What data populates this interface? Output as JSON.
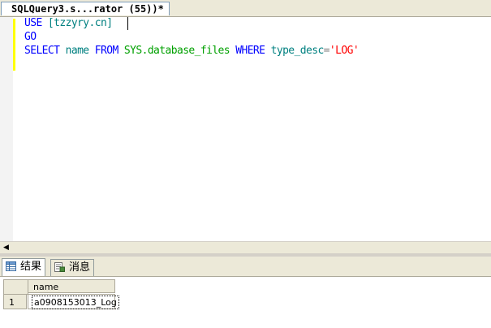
{
  "document_tab": {
    "title": "SQLQuery3.s...rator (55))*"
  },
  "editor": {
    "line1": {
      "kw_use": "USE",
      "db": "[tzzyry.cn]"
    },
    "line2": {
      "kw_go": "GO"
    },
    "line3": {
      "kw_select": "SELECT",
      "col": "name",
      "kw_from": "FROM",
      "table": "SYS.database_files",
      "kw_where": "WHERE",
      "filter_col": "type_desc",
      "op": "=",
      "value": "'LOG'"
    }
  },
  "result_tabs": [
    {
      "label": "结果",
      "icon": "grid-icon"
    },
    {
      "label": "消息",
      "icon": "messages-icon"
    }
  ],
  "grid": {
    "columns": [
      "name"
    ],
    "rows": [
      {
        "row_number": "1",
        "name": "a0908153013_Log"
      }
    ]
  },
  "colors": {
    "keyword": "#0000ff",
    "identifier": "#008080",
    "system_object": "#00a000",
    "string": "#ff0000",
    "changebar": "#ffff00"
  }
}
